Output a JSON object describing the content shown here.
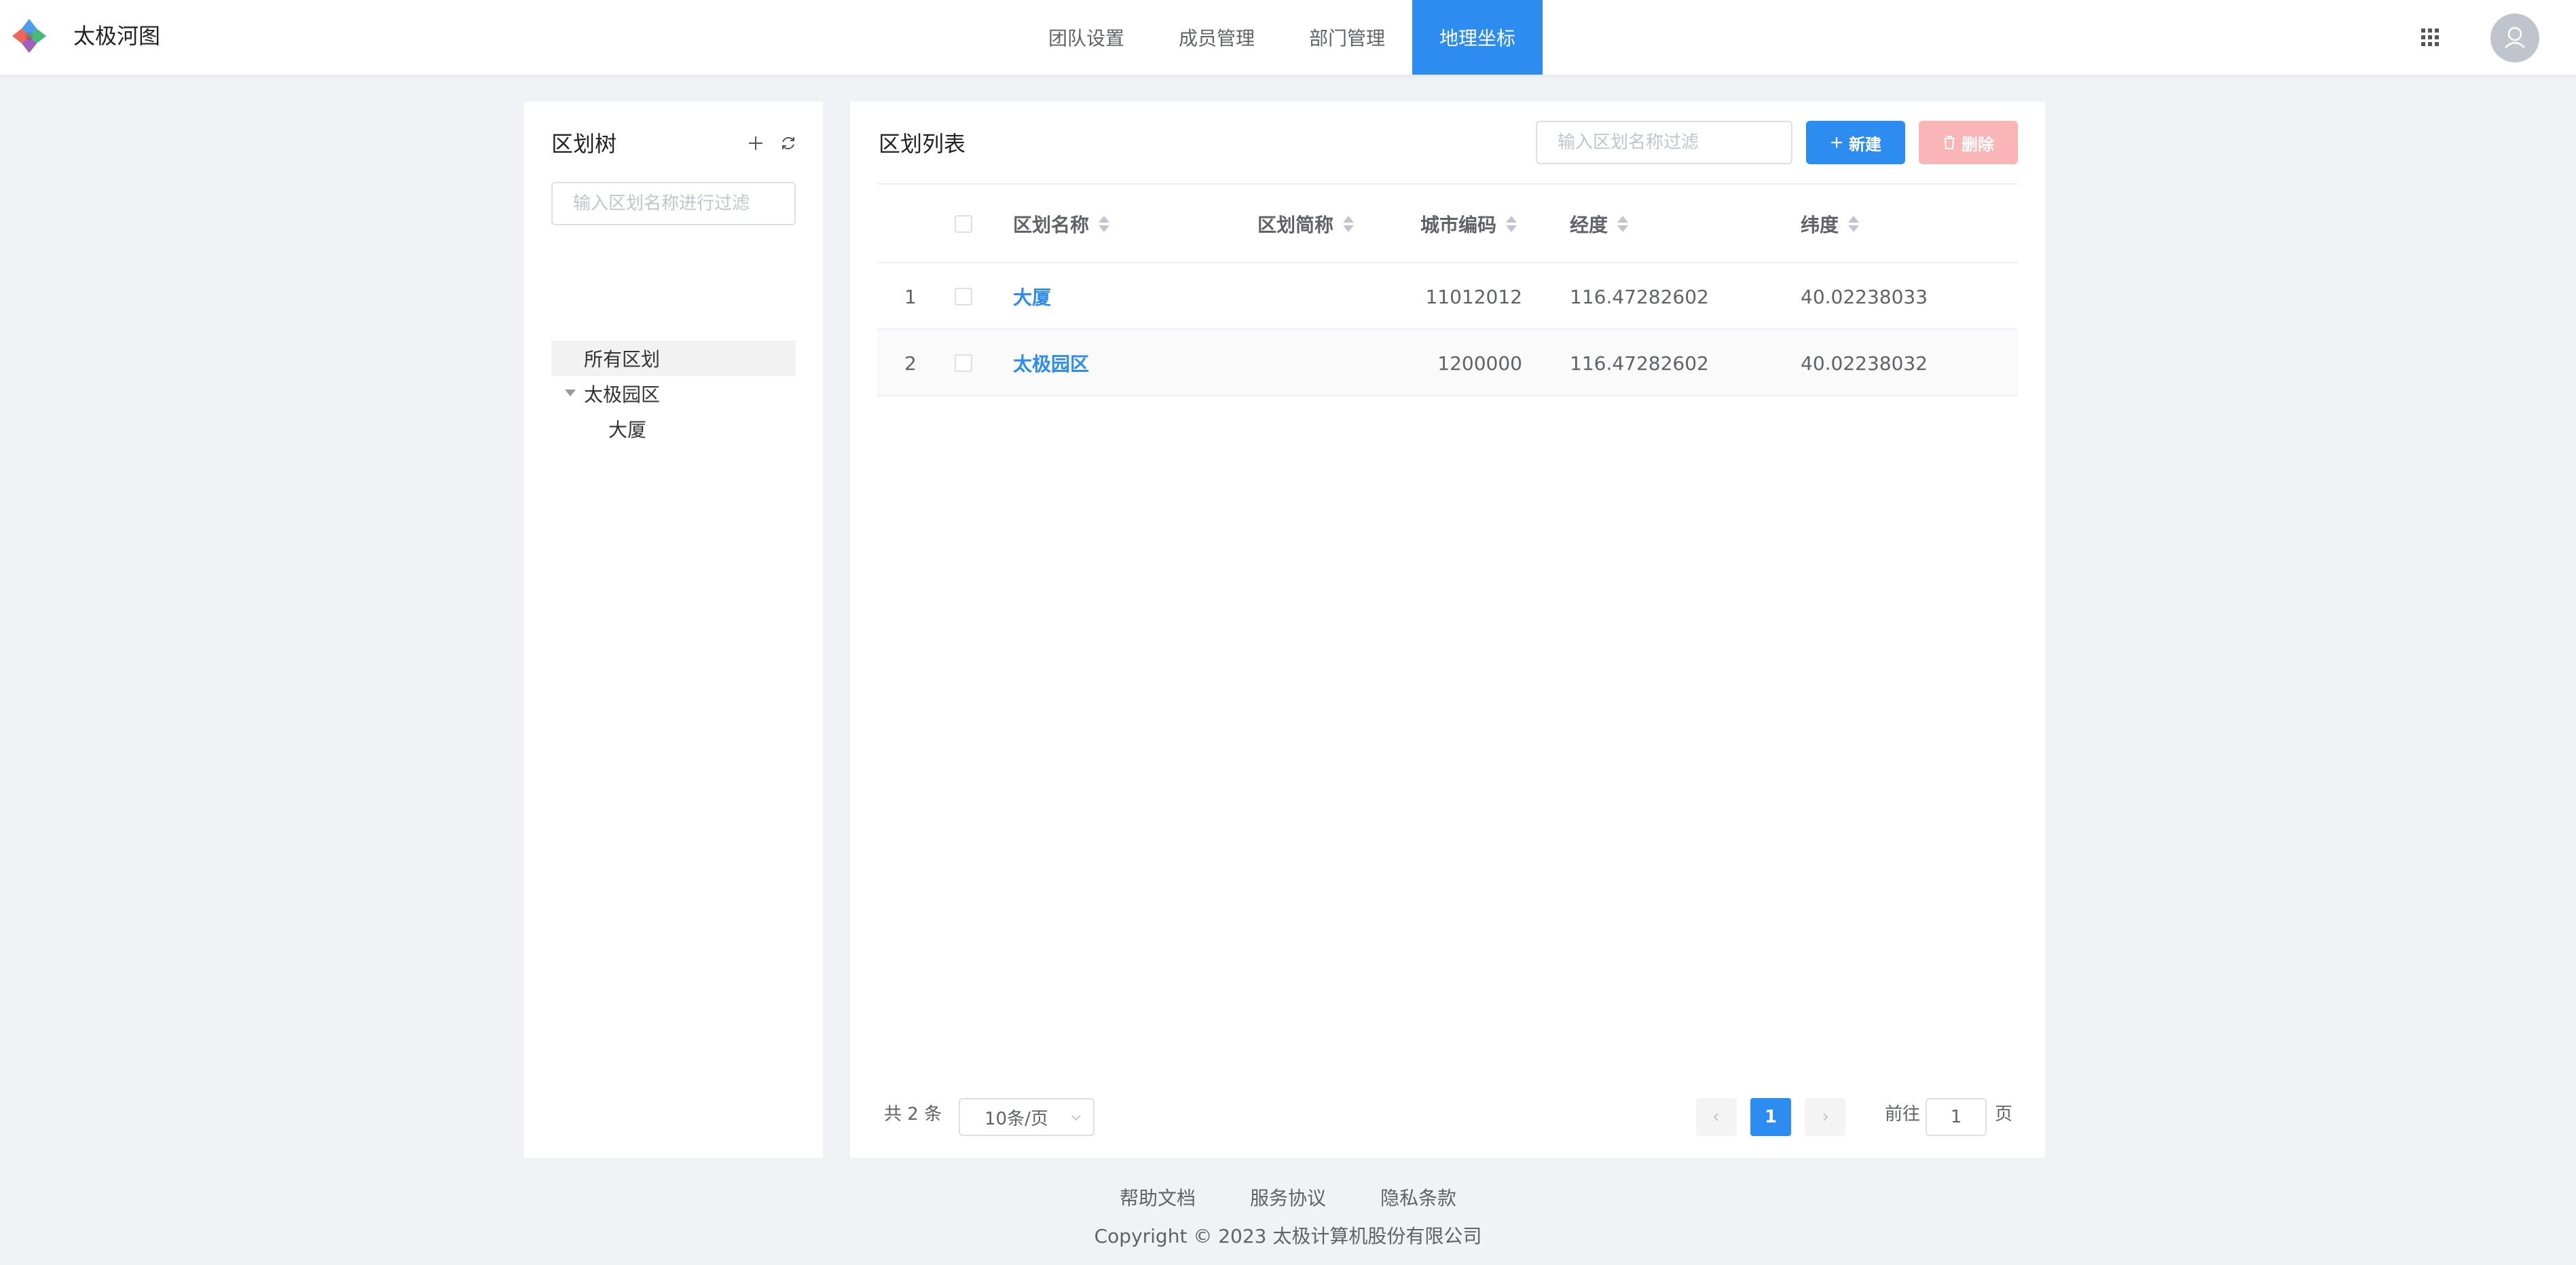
{
  "header": {
    "app_title": "太极河图",
    "nav": [
      {
        "label": "团队设置",
        "active": false
      },
      {
        "label": "成员管理",
        "active": false
      },
      {
        "label": "部门管理",
        "active": false
      },
      {
        "label": "地理坐标",
        "active": true
      }
    ],
    "icons": {
      "apps": "grid-icon",
      "user": "avatar-icon"
    },
    "accent_color": "#2d8cf0"
  },
  "tree_panel": {
    "title": "区划树",
    "search_placeholder": "输入区划名称进行过滤",
    "nodes": [
      {
        "label": "所有区划",
        "level": 0,
        "selected": true
      },
      {
        "label": "太极园区",
        "level": 1,
        "expanded": true
      },
      {
        "label": "大厦",
        "level": 2
      }
    ]
  },
  "list_panel": {
    "title": "区划列表",
    "search_placeholder": "输入区划名称过滤",
    "new_label": "新建",
    "delete_label": "删除",
    "columns": [
      "区划名称",
      "区划简称",
      "城市编码",
      "经度",
      "纬度"
    ],
    "rows": [
      {
        "index": "1",
        "name": "大厦",
        "short": "",
        "code": "11012012",
        "lng": "116.47282602",
        "lat": "40.02238033"
      },
      {
        "index": "2",
        "name": "太极园区",
        "short": "",
        "code": "1200000",
        "lng": "116.47282602",
        "lat": "40.02238032"
      }
    ],
    "pagination": {
      "total": "共 2 条",
      "page_size": "10条/页",
      "current_page": "1",
      "goto_label": "前往",
      "goto_value": "1",
      "goto_suffix": "页"
    }
  },
  "footer": {
    "links": [
      "帮助文档",
      "服务协议",
      "隐私条款"
    ],
    "copyright": "Copyright © 2023 太极计算机股份有限公司"
  }
}
